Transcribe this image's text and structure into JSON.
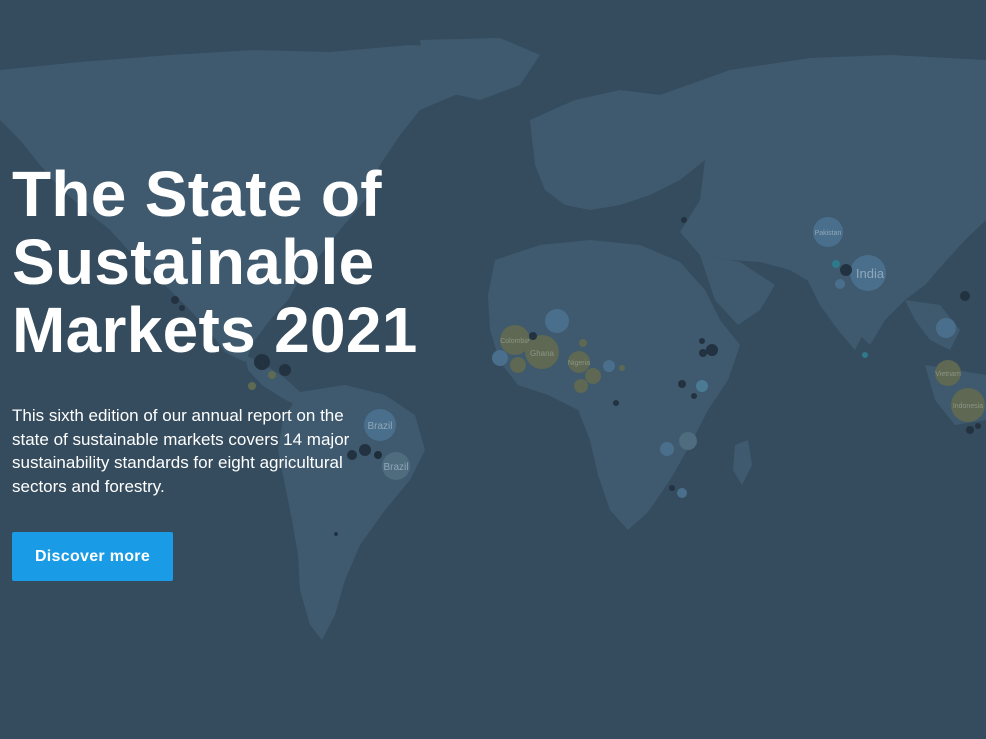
{
  "hero": {
    "title_line1": "The State of",
    "title_line2": "Sustainable",
    "title_line3": "Markets 2021",
    "description": "This sixth edition of our annual report on the state of sustainable markets covers 14 major sustainability standards for eight agricultural sectors and forestry.",
    "cta_label": "Discover more"
  },
  "map": {
    "icon": "world-map-bubble-icon",
    "labels": {
      "pakistan": "Pakistan",
      "india": "India",
      "brazil1": "Brazil",
      "brazil2": "Brazil",
      "colombia": "Colombia",
      "ghana": "Ghana",
      "nigeria": "Nigeria",
      "vietnam": "Vietnam",
      "indonesia": "Indonesia"
    }
  },
  "colors": {
    "background": "#354c5e",
    "land": "#3f5a6e",
    "button": "#1a9be6"
  }
}
